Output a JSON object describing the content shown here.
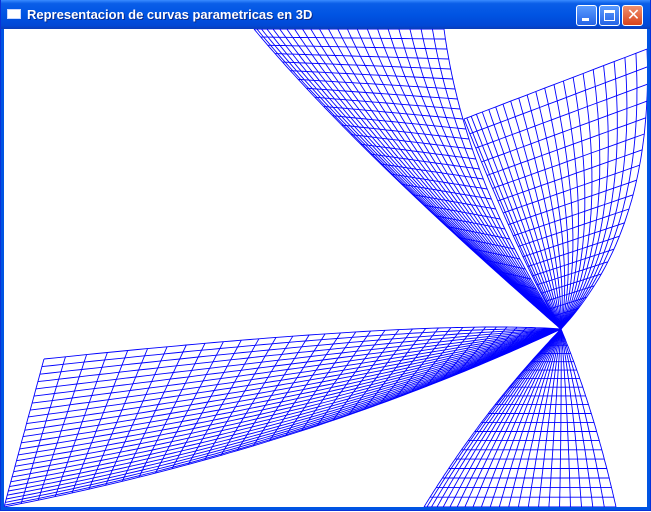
{
  "window": {
    "title": "Representacion de curvas parametricas en 3D",
    "icon": "app-window-icon",
    "controls": {
      "minimize": "minimize-icon",
      "maximize": "maximize-icon",
      "close": "close-icon",
      "close_glyph": "✕"
    }
  },
  "plot": {
    "line_color": "#0000ff",
    "background": "#ffffff"
  }
}
